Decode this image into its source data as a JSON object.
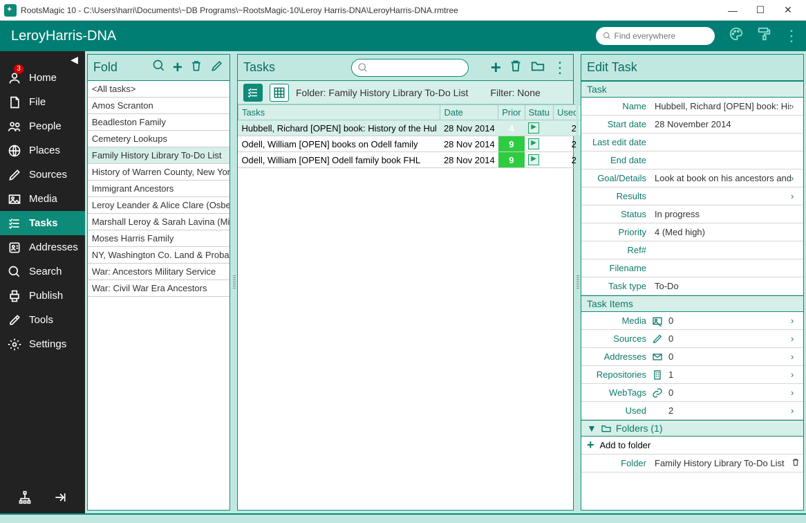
{
  "window": {
    "title": "RootsMagic 10 - C:\\Users\\harri\\Documents\\~DB Programs\\~RootsMagic-10\\Leroy Harris-DNA\\LeroyHarris-DNA.rmtree"
  },
  "topbar": {
    "db_name": "LeroyHarris-DNA",
    "search_placeholder": "Find everywhere"
  },
  "sidebar": {
    "badge": "3",
    "items": [
      {
        "label": "Home",
        "icon": "user"
      },
      {
        "label": "File",
        "icon": "file"
      },
      {
        "label": "People",
        "icon": "people"
      },
      {
        "label": "Places",
        "icon": "globe"
      },
      {
        "label": "Sources",
        "icon": "pen"
      },
      {
        "label": "Media",
        "icon": "image"
      },
      {
        "label": "Tasks",
        "icon": "checklist",
        "active": true
      },
      {
        "label": "Addresses",
        "icon": "address"
      },
      {
        "label": "Search",
        "icon": "search"
      },
      {
        "label": "Publish",
        "icon": "print"
      },
      {
        "label": "Tools",
        "icon": "tools"
      },
      {
        "label": "Settings",
        "icon": "gear"
      }
    ]
  },
  "folders": {
    "title": "Fold",
    "items": [
      "<All tasks>",
      "Amos Scranton",
      "Beadleston Family",
      "Cemetery Lookups",
      "Family History Library To-Do List",
      "History of Warren County, New York",
      "Immigrant Ancestors",
      "Leroy Leander & Alice Clare (Osberg)",
      "Marshall Leroy & Sarah Lavina (Miller)",
      "Moses Harris Family",
      "NY, Washington Co. Land & Probate l",
      "War: Ancestors Military Service",
      "War: Civil War Era Ancestors"
    ],
    "selected_index": 4
  },
  "tasks": {
    "title": "Tasks",
    "sub_folder": "Folder: Family History Library To-Do List",
    "sub_filter": "Filter: None",
    "columns": [
      "Tasks",
      "Date",
      "Prior",
      "Statu",
      "Used"
    ],
    "rows": [
      {
        "task": "Hubbell, Richard [OPEN] book: History of the Hul",
        "date": "28 Nov 2014",
        "prio": "4",
        "prio_class": "prio-4",
        "used": "2",
        "sel": true
      },
      {
        "task": "Odell, William [OPEN] books on Odell family",
        "date": "28 Nov 2014",
        "prio": "9",
        "prio_class": "prio-9",
        "used": "2"
      },
      {
        "task": "Odell, William [OPEN] Odell family book FHL",
        "date": "28 Nov 2014",
        "prio": "9",
        "prio_class": "prio-9",
        "used": "2"
      }
    ]
  },
  "edit": {
    "title": "Edit Task",
    "section_task": "Task",
    "fields": {
      "name_l": "Name",
      "name_v": "Hubbell, Richard [OPEN] book: History of",
      "start_l": "Start date",
      "start_v": "28 November 2014",
      "lastedit_l": "Last edit date",
      "lastedit_v": "",
      "end_l": "End date",
      "end_v": "",
      "goal_l": "Goal/Details",
      "goal_v": "Look at book on his ancestors and...",
      "results_l": "Results",
      "results_v": "",
      "status_l": "Status",
      "status_v": "In progress",
      "priority_l": "Priority",
      "priority_v": "4 (Med high)",
      "ref_l": "Ref#",
      "ref_v": "",
      "filename_l": "Filename",
      "filename_v": "",
      "tasktype_l": "Task type",
      "tasktype_v": "To-Do"
    },
    "section_items": "Task Items",
    "items": {
      "media_l": "Media",
      "media_v": "0",
      "sources_l": "Sources",
      "sources_v": "0",
      "addresses_l": "Addresses",
      "addresses_v": "0",
      "repos_l": "Repositories",
      "repos_v": "1",
      "webtags_l": "WebTags",
      "webtags_v": "0",
      "used_l": "Used",
      "used_v": "2"
    },
    "folders_header": "Folders (1)",
    "add_folder": "Add to folder",
    "folder_l": "Folder",
    "folder_v": "Family History Library To-Do List"
  }
}
